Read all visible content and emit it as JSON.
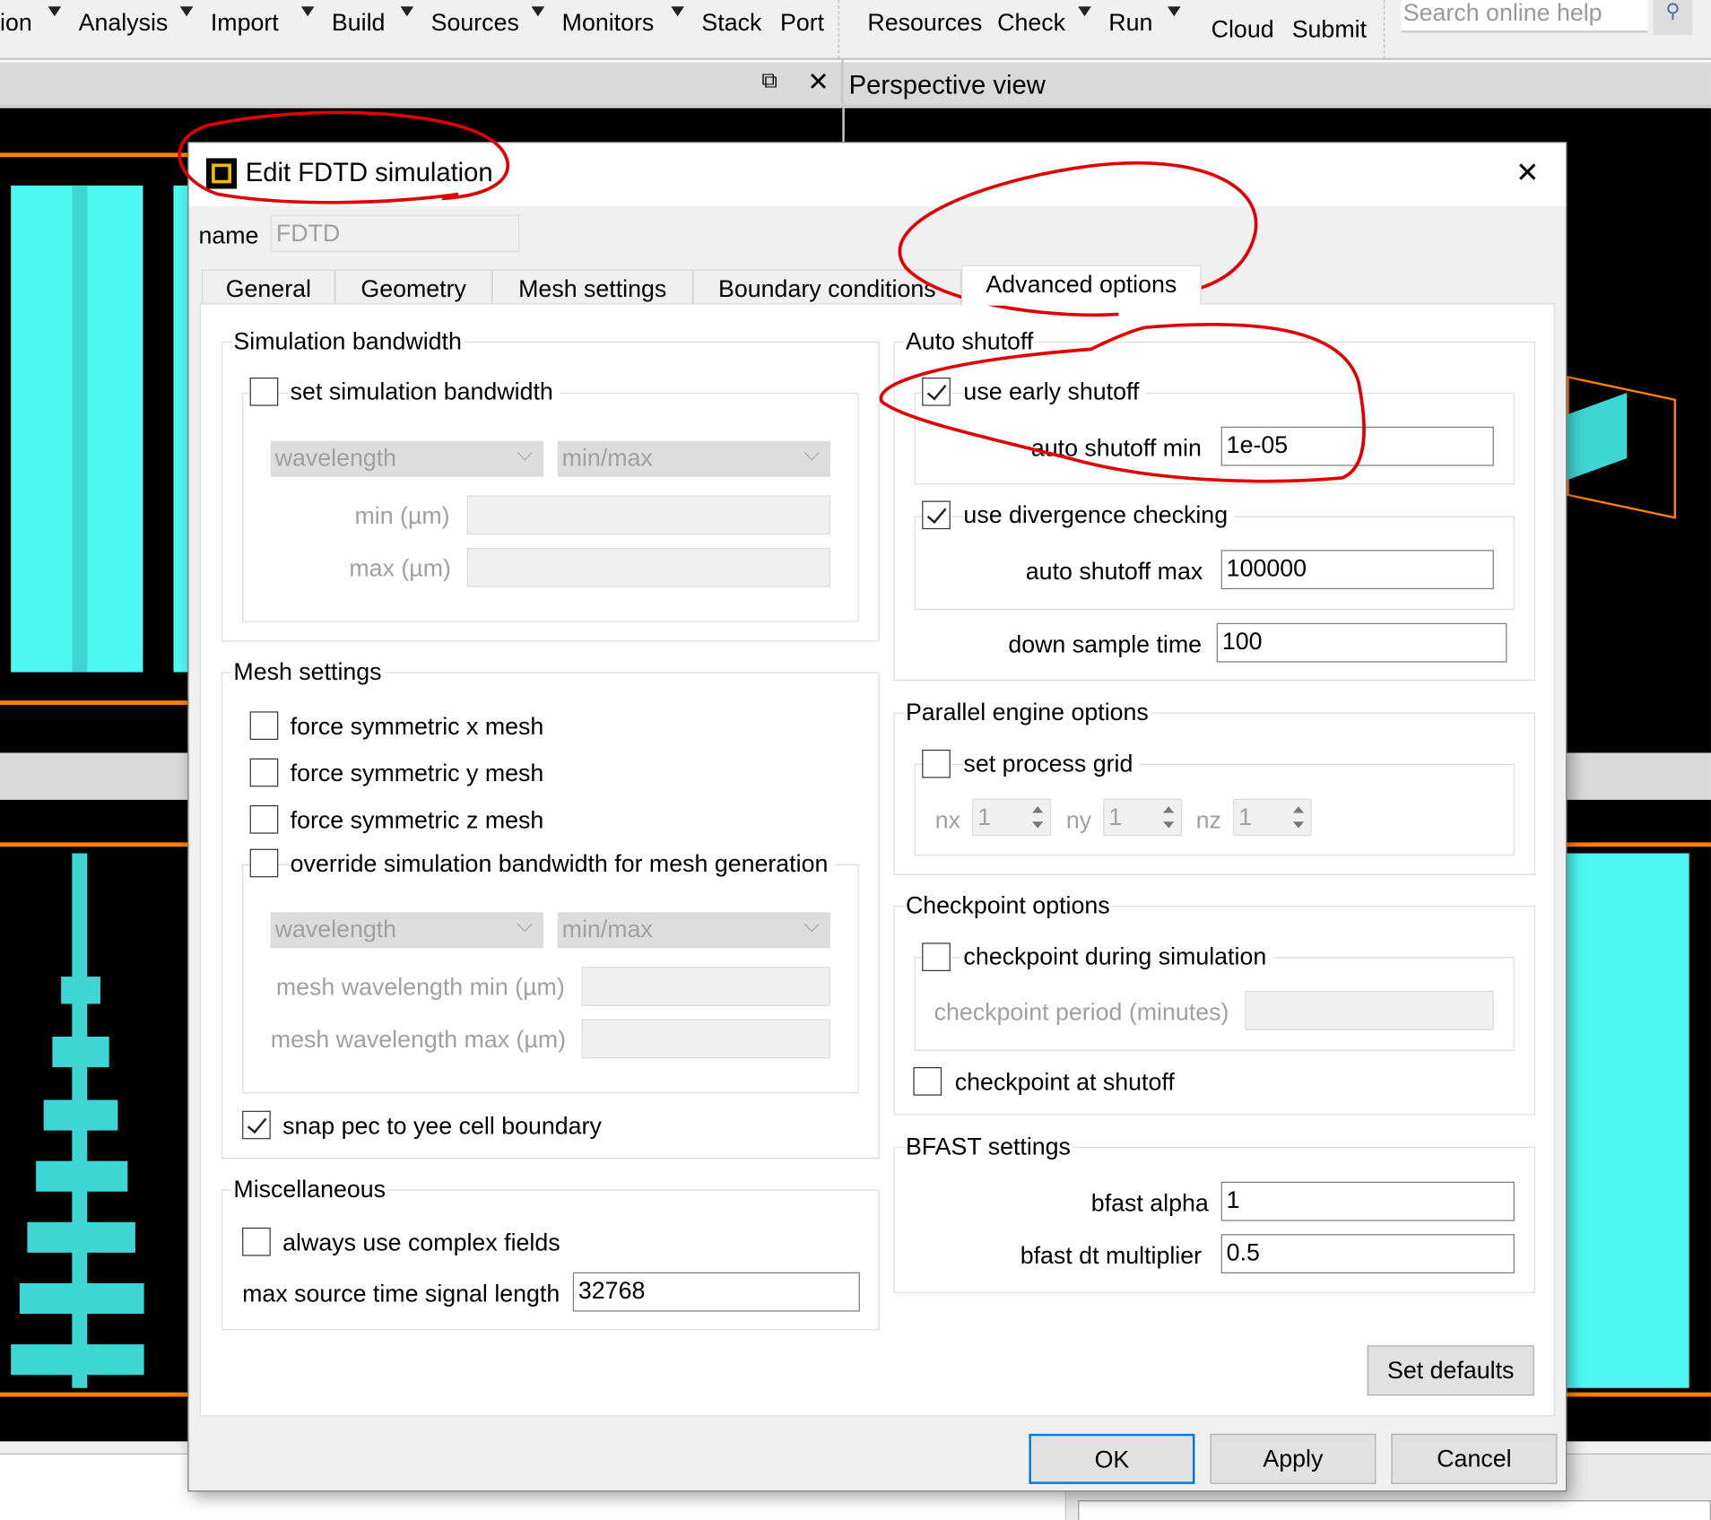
{
  "menubar": {
    "items": [
      {
        "label": "ion",
        "dropdown": true
      },
      {
        "label": "Analysis",
        "dropdown": true
      },
      {
        "label": "Import",
        "dropdown": true
      },
      {
        "label": "Build",
        "dropdown": true
      },
      {
        "label": "Sources",
        "dropdown": true
      },
      {
        "label": "Monitors",
        "dropdown": true
      },
      {
        "label": "Stack",
        "dropdown": false
      },
      {
        "label": "Port",
        "dropdown": false
      },
      {
        "label": "Resources",
        "dropdown": false
      },
      {
        "label": "Check",
        "dropdown": true
      },
      {
        "label": "Run",
        "dropdown": true
      },
      {
        "label": "Cloud",
        "dropdown": false
      },
      {
        "label": "Submit",
        "dropdown": false
      }
    ],
    "search_placeholder": "Search online help"
  },
  "viewbar": {
    "title": "Perspective view"
  },
  "dialog": {
    "title": "Edit FDTD simulation",
    "name_label": "name",
    "name_value": "FDTD",
    "tabs": [
      "General",
      "Geometry",
      "Mesh settings",
      "Boundary conditions",
      "Advanced options"
    ],
    "active_tab": "Advanced options",
    "sim_bandwidth": {
      "title": "Simulation bandwidth",
      "set_label": "set simulation bandwidth",
      "set_checked": false,
      "unit_select": "wavelength",
      "range_select": "min/max",
      "min_label": "min (µm)",
      "max_label": "max (µm)",
      "min_value": "",
      "max_value": ""
    },
    "mesh": {
      "title": "Mesh settings",
      "sym_x": "force symmetric x mesh",
      "sym_x_checked": false,
      "sym_y": "force symmetric y mesh",
      "sym_y_checked": false,
      "sym_z": "force symmetric z mesh",
      "sym_z_checked": false,
      "override": "override simulation bandwidth for mesh generation",
      "override_checked": false,
      "unit_select": "wavelength",
      "range_select": "min/max",
      "wl_min_label": "mesh wavelength min (µm)",
      "wl_max_label": "mesh wavelength max (µm)",
      "snap": "snap pec to yee cell boundary",
      "snap_checked": true
    },
    "misc": {
      "title": "Miscellaneous",
      "complex": "always use complex fields",
      "complex_checked": false,
      "max_len_label": "max source time signal length",
      "max_len_value": "32768"
    },
    "auto_shutoff": {
      "title": "Auto shutoff",
      "early": "use early shutoff",
      "early_checked": true,
      "min_label": "auto shutoff min",
      "min_value": "1e-05",
      "div": "use divergence checking",
      "div_checked": true,
      "max_label": "auto shutoff max",
      "max_value": "100000",
      "down_label": "down sample time",
      "down_value": "100"
    },
    "parallel": {
      "title": "Parallel engine options",
      "grid": "set process grid",
      "grid_checked": false,
      "nx_label": "nx",
      "nx": "1",
      "ny_label": "ny",
      "ny": "1",
      "nz_label": "nz",
      "nz": "1"
    },
    "checkpoint": {
      "title": "Checkpoint options",
      "during": "checkpoint during simulation",
      "during_checked": false,
      "period_label": "checkpoint period (minutes)",
      "at_shutoff": "checkpoint at shutoff",
      "at_shutoff_checked": false
    },
    "bfast": {
      "title": "BFAST settings",
      "alpha_label": "bfast alpha",
      "alpha_value": "1",
      "dt_label": "bfast dt multiplier",
      "dt_value": "0.5"
    },
    "buttons": {
      "set_defaults": "Set defaults",
      "ok": "OK",
      "apply": "Apply",
      "cancel": "Cancel"
    }
  },
  "colors": {
    "annotation": "#e00000",
    "accent": "#0078d7",
    "cyan": "#4ef9f5",
    "orange": "#ff7f00"
  }
}
